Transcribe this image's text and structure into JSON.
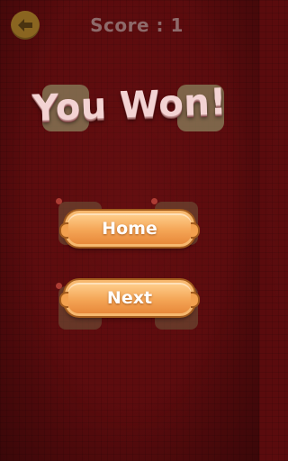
{
  "header": {
    "score_text": "Score : 1"
  },
  "icons": {
    "back": "arrow-left-icon"
  },
  "result": {
    "title": "You Won!"
  },
  "buttons": {
    "home_label": "Home",
    "next_label": "Next"
  },
  "colors": {
    "background": "#5a0b0d",
    "button_fill": "#f4a556",
    "button_outline": "#a35c1d",
    "back_button": "#8a6520"
  }
}
